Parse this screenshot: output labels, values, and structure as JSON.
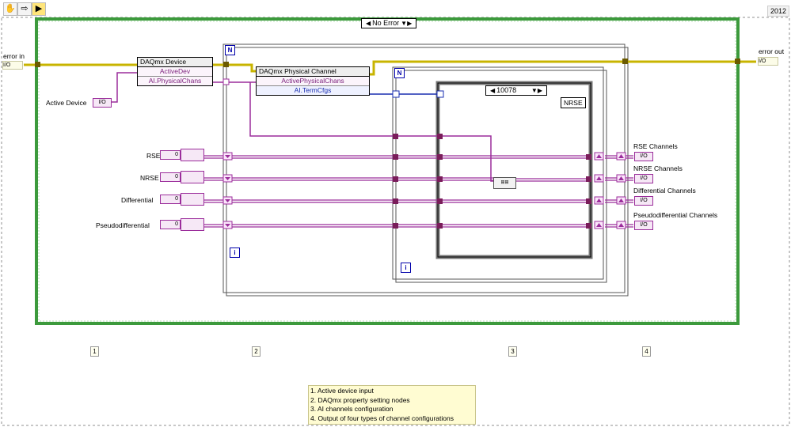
{
  "toolbar": {
    "run_icon": "run-arrow-icon",
    "hand_icon": "hand-icon",
    "step_icon": "step-icon",
    "highlight_icon": "highlight-icon",
    "version": "2012"
  },
  "error_case": {
    "selector": "No Error"
  },
  "terminals": {
    "error_in": "error in",
    "error_out": "error out",
    "active_device": "Active Device",
    "error_cluster_glyph": "I/O"
  },
  "node_device": {
    "title": "DAQmx Device",
    "prop_in": "ActiveDev",
    "prop_out": "AI.PhysicalChans"
  },
  "node_channel": {
    "title": "DAQmx Physical Channel",
    "prop_in": "ActivePhysicalChans",
    "prop_out": "AI.TermCfgs"
  },
  "loop_labels": {
    "count": "N",
    "iteration": "i"
  },
  "inner_case": {
    "selector": "10078",
    "label": "NRSE"
  },
  "inputs": [
    {
      "label": "RSE",
      "value": "0"
    },
    {
      "label": "NRSE",
      "value": "0"
    },
    {
      "label": "Differential",
      "value": "0"
    },
    {
      "label": "Pseudodifferential",
      "value": "0"
    }
  ],
  "outputs": [
    {
      "label": "RSE Channels",
      "glyph": "I/O"
    },
    {
      "label": "NRSE Channels",
      "glyph": "I/O"
    },
    {
      "label": "Differential Channels",
      "glyph": "I/O"
    },
    {
      "label": "Pseudodifferential Channels",
      "glyph": "I/O"
    }
  ],
  "callouts": [
    "1",
    "2",
    "3",
    "4"
  ],
  "legend": [
    "1. Active device input",
    "2. DAQmx property setting nodes",
    "3. AI channels configuration",
    "4. Output of four types of channel configurations"
  ],
  "colors": {
    "error_wire": "#c8b400",
    "ref_wire": "#9b2d9b",
    "enum_wire": "#1a2fb0",
    "loop_border": "#3c9a3c"
  }
}
